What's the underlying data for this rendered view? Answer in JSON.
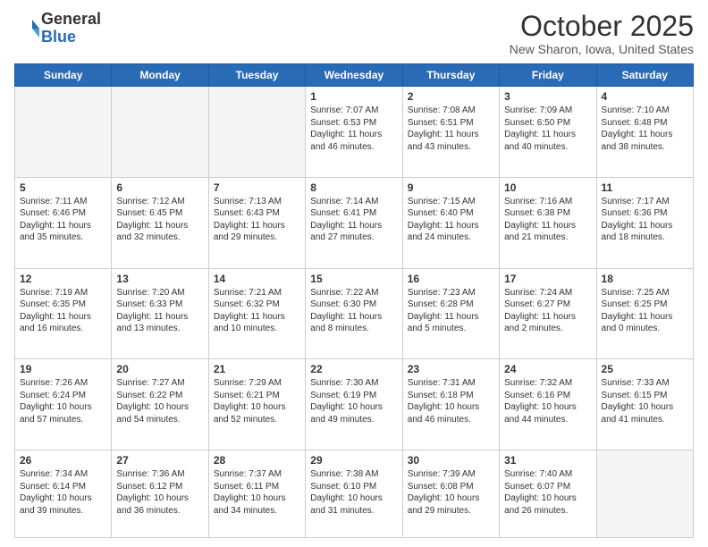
{
  "header": {
    "logo_general": "General",
    "logo_blue": "Blue",
    "month": "October 2025",
    "location": "New Sharon, Iowa, United States"
  },
  "days_of_week": [
    "Sunday",
    "Monday",
    "Tuesday",
    "Wednesday",
    "Thursday",
    "Friday",
    "Saturday"
  ],
  "weeks": [
    [
      {
        "day": "",
        "info": ""
      },
      {
        "day": "",
        "info": ""
      },
      {
        "day": "",
        "info": ""
      },
      {
        "day": "1",
        "info": "Sunrise: 7:07 AM\nSunset: 6:53 PM\nDaylight: 11 hours\nand 46 minutes."
      },
      {
        "day": "2",
        "info": "Sunrise: 7:08 AM\nSunset: 6:51 PM\nDaylight: 11 hours\nand 43 minutes."
      },
      {
        "day": "3",
        "info": "Sunrise: 7:09 AM\nSunset: 6:50 PM\nDaylight: 11 hours\nand 40 minutes."
      },
      {
        "day": "4",
        "info": "Sunrise: 7:10 AM\nSunset: 6:48 PM\nDaylight: 11 hours\nand 38 minutes."
      }
    ],
    [
      {
        "day": "5",
        "info": "Sunrise: 7:11 AM\nSunset: 6:46 PM\nDaylight: 11 hours\nand 35 minutes."
      },
      {
        "day": "6",
        "info": "Sunrise: 7:12 AM\nSunset: 6:45 PM\nDaylight: 11 hours\nand 32 minutes."
      },
      {
        "day": "7",
        "info": "Sunrise: 7:13 AM\nSunset: 6:43 PM\nDaylight: 11 hours\nand 29 minutes."
      },
      {
        "day": "8",
        "info": "Sunrise: 7:14 AM\nSunset: 6:41 PM\nDaylight: 11 hours\nand 27 minutes."
      },
      {
        "day": "9",
        "info": "Sunrise: 7:15 AM\nSunset: 6:40 PM\nDaylight: 11 hours\nand 24 minutes."
      },
      {
        "day": "10",
        "info": "Sunrise: 7:16 AM\nSunset: 6:38 PM\nDaylight: 11 hours\nand 21 minutes."
      },
      {
        "day": "11",
        "info": "Sunrise: 7:17 AM\nSunset: 6:36 PM\nDaylight: 11 hours\nand 18 minutes."
      }
    ],
    [
      {
        "day": "12",
        "info": "Sunrise: 7:19 AM\nSunset: 6:35 PM\nDaylight: 11 hours\nand 16 minutes."
      },
      {
        "day": "13",
        "info": "Sunrise: 7:20 AM\nSunset: 6:33 PM\nDaylight: 11 hours\nand 13 minutes."
      },
      {
        "day": "14",
        "info": "Sunrise: 7:21 AM\nSunset: 6:32 PM\nDaylight: 11 hours\nand 10 minutes."
      },
      {
        "day": "15",
        "info": "Sunrise: 7:22 AM\nSunset: 6:30 PM\nDaylight: 11 hours\nand 8 minutes."
      },
      {
        "day": "16",
        "info": "Sunrise: 7:23 AM\nSunset: 6:28 PM\nDaylight: 11 hours\nand 5 minutes."
      },
      {
        "day": "17",
        "info": "Sunrise: 7:24 AM\nSunset: 6:27 PM\nDaylight: 11 hours\nand 2 minutes."
      },
      {
        "day": "18",
        "info": "Sunrise: 7:25 AM\nSunset: 6:25 PM\nDaylight: 11 hours\nand 0 minutes."
      }
    ],
    [
      {
        "day": "19",
        "info": "Sunrise: 7:26 AM\nSunset: 6:24 PM\nDaylight: 10 hours\nand 57 minutes."
      },
      {
        "day": "20",
        "info": "Sunrise: 7:27 AM\nSunset: 6:22 PM\nDaylight: 10 hours\nand 54 minutes."
      },
      {
        "day": "21",
        "info": "Sunrise: 7:29 AM\nSunset: 6:21 PM\nDaylight: 10 hours\nand 52 minutes."
      },
      {
        "day": "22",
        "info": "Sunrise: 7:30 AM\nSunset: 6:19 PM\nDaylight: 10 hours\nand 49 minutes."
      },
      {
        "day": "23",
        "info": "Sunrise: 7:31 AM\nSunset: 6:18 PM\nDaylight: 10 hours\nand 46 minutes."
      },
      {
        "day": "24",
        "info": "Sunrise: 7:32 AM\nSunset: 6:16 PM\nDaylight: 10 hours\nand 44 minutes."
      },
      {
        "day": "25",
        "info": "Sunrise: 7:33 AM\nSunset: 6:15 PM\nDaylight: 10 hours\nand 41 minutes."
      }
    ],
    [
      {
        "day": "26",
        "info": "Sunrise: 7:34 AM\nSunset: 6:14 PM\nDaylight: 10 hours\nand 39 minutes."
      },
      {
        "day": "27",
        "info": "Sunrise: 7:36 AM\nSunset: 6:12 PM\nDaylight: 10 hours\nand 36 minutes."
      },
      {
        "day": "28",
        "info": "Sunrise: 7:37 AM\nSunset: 6:11 PM\nDaylight: 10 hours\nand 34 minutes."
      },
      {
        "day": "29",
        "info": "Sunrise: 7:38 AM\nSunset: 6:10 PM\nDaylight: 10 hours\nand 31 minutes."
      },
      {
        "day": "30",
        "info": "Sunrise: 7:39 AM\nSunset: 6:08 PM\nDaylight: 10 hours\nand 29 minutes."
      },
      {
        "day": "31",
        "info": "Sunrise: 7:40 AM\nSunset: 6:07 PM\nDaylight: 10 hours\nand 26 minutes."
      },
      {
        "day": "",
        "info": ""
      }
    ]
  ]
}
